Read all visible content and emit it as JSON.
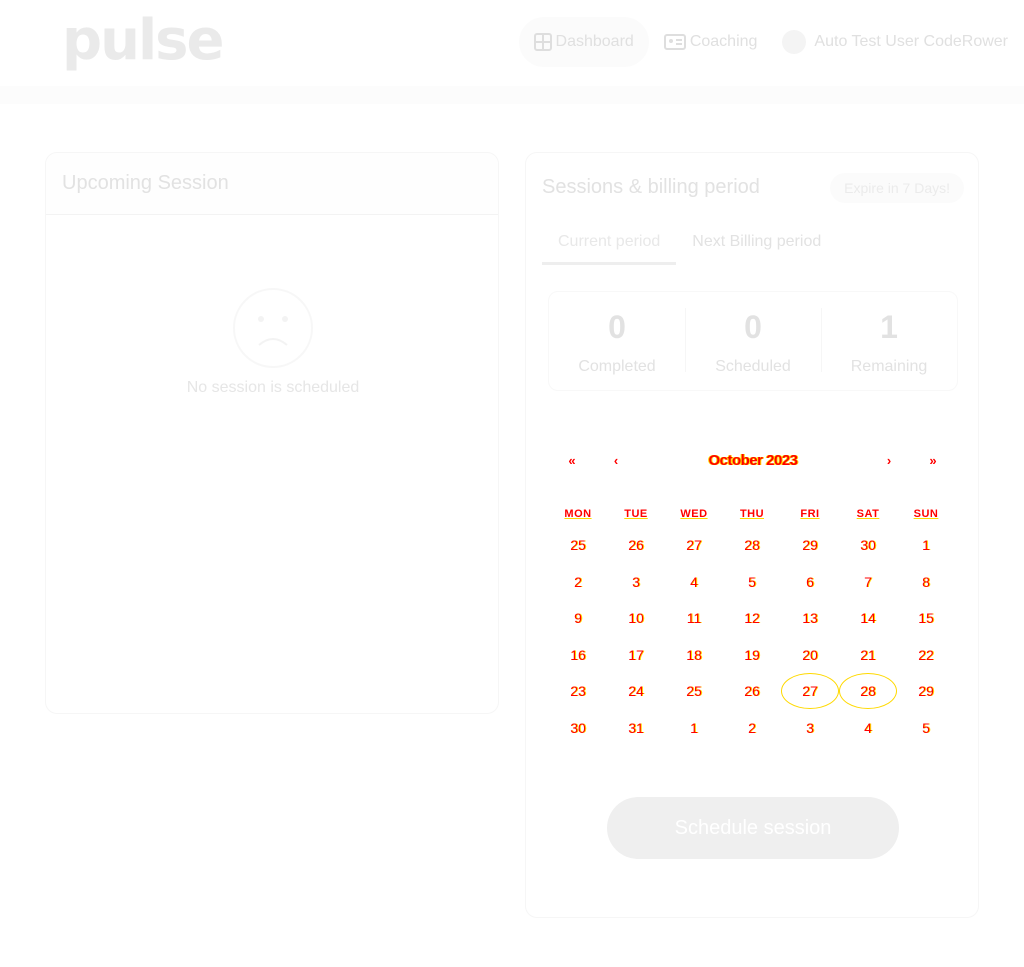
{
  "header": {
    "logo": "pulse",
    "nav": [
      {
        "label": "Dashboard",
        "icon": "grid-icon",
        "active": true
      },
      {
        "label": "Coaching",
        "icon": "id-card-icon",
        "active": false
      }
    ],
    "user_name": "Auto Test User CodeRower"
  },
  "upcoming": {
    "title": "Upcoming Session",
    "empty_icon": "sad-face-icon",
    "empty_text": "No session is scheduled"
  },
  "sessions": {
    "title": "Sessions & billing period",
    "expire_badge": "Expire in 7 Days!",
    "tabs": [
      {
        "label": "Current period",
        "active": true
      },
      {
        "label": "Next Billing period",
        "active": false
      }
    ],
    "stats": [
      {
        "value": "0",
        "label": "Completed"
      },
      {
        "value": "0",
        "label": "Scheduled"
      },
      {
        "value": "1",
        "label": "Remaining"
      }
    ],
    "calendar": {
      "month_label": "October 2023",
      "prev_year": "«",
      "prev_month": "‹",
      "next_month": "›",
      "next_year": "»",
      "weekdays": [
        "MON",
        "TUE",
        "WED",
        "THU",
        "FRI",
        "SAT",
        "SUN"
      ],
      "weeks": [
        [
          "25",
          "26",
          "27",
          "28",
          "29",
          "30",
          "1"
        ],
        [
          "2",
          "3",
          "4",
          "5",
          "6",
          "7",
          "8"
        ],
        [
          "9",
          "10",
          "11",
          "12",
          "13",
          "14",
          "15"
        ],
        [
          "16",
          "17",
          "18",
          "19",
          "20",
          "21",
          "22"
        ],
        [
          "23",
          "24",
          "25",
          "26",
          "27",
          "28",
          "29"
        ],
        [
          "30",
          "31",
          "1",
          "2",
          "3",
          "4",
          "5"
        ]
      ],
      "highlighted_days": [
        "27",
        "28"
      ]
    },
    "schedule_button": "Schedule session"
  },
  "colors": {
    "calendar_text": "#ff0000",
    "calendar_outline": "#ffd900",
    "button_bg": "#efefef"
  }
}
